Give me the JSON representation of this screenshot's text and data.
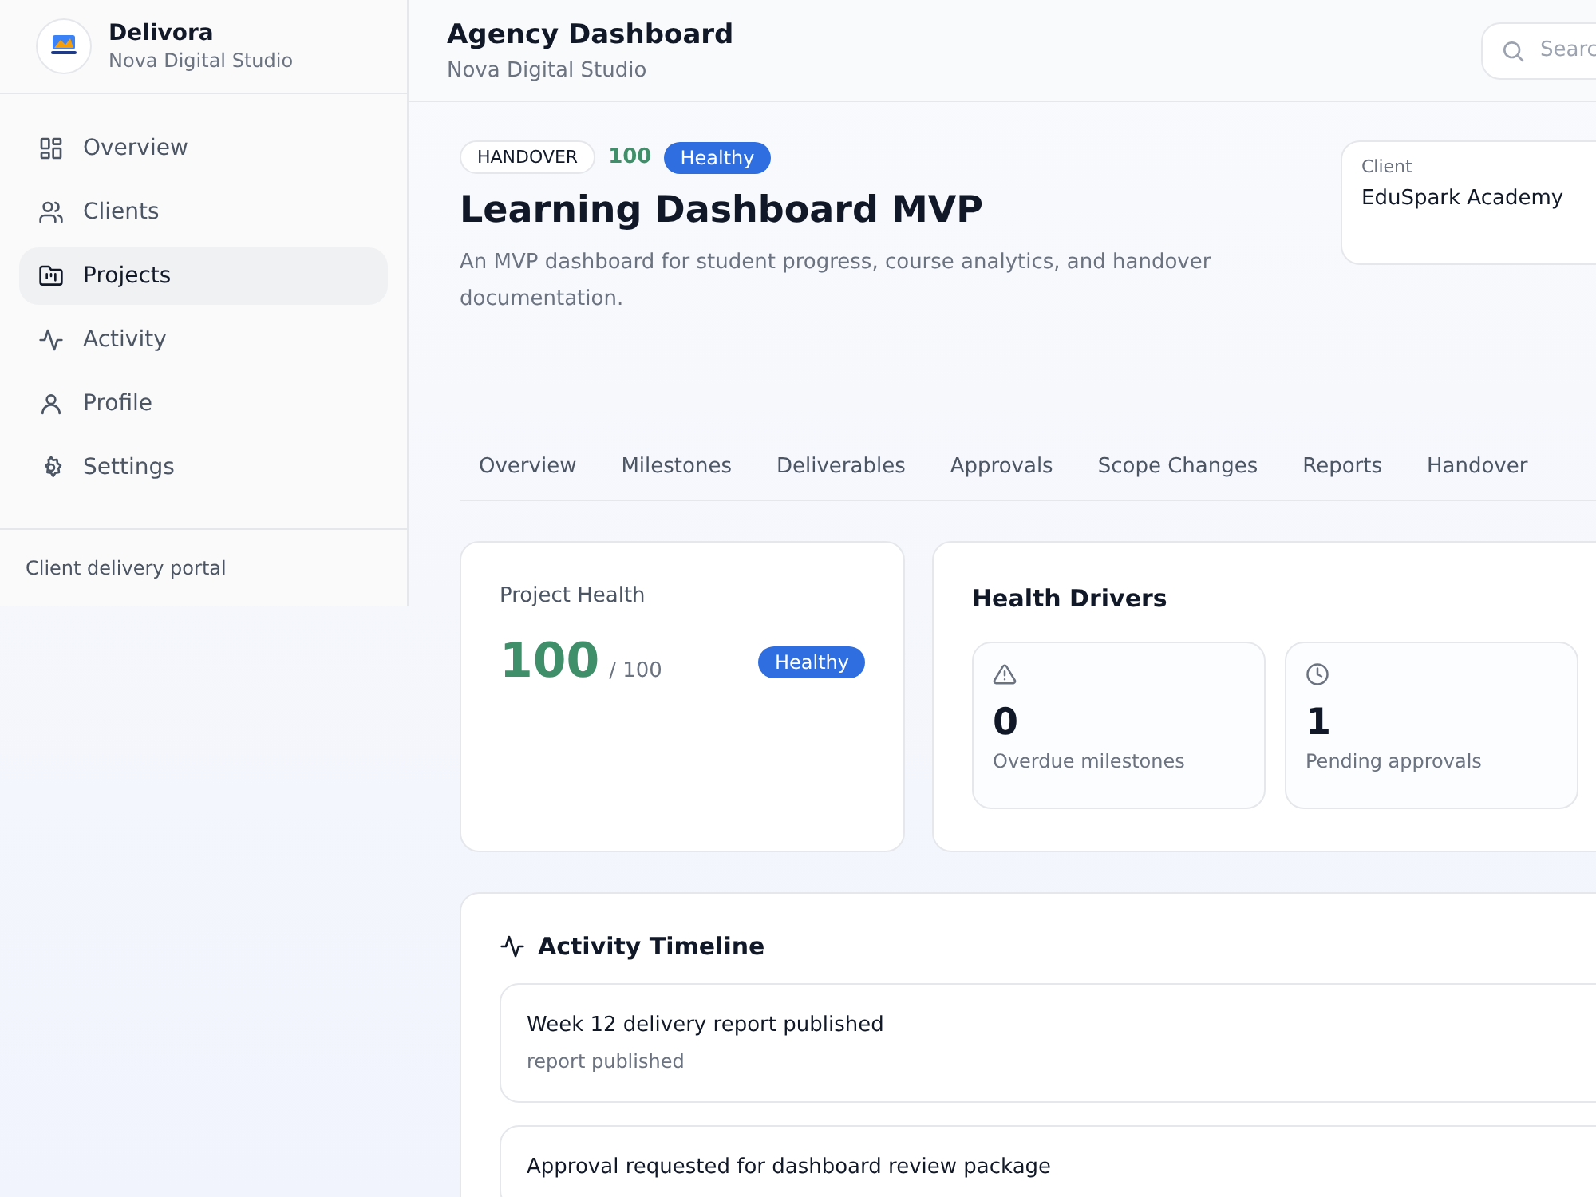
{
  "sidebar": {
    "brand": {
      "name": "Delivora",
      "org": "Nova Digital Studio"
    },
    "items": [
      {
        "label": "Overview",
        "kind": "grid",
        "selected": false
      },
      {
        "label": "Clients",
        "kind": "users",
        "selected": false
      },
      {
        "label": "Projects",
        "kind": "folder",
        "selected": true
      },
      {
        "label": "Activity",
        "kind": "pulse",
        "selected": false
      },
      {
        "label": "Profile",
        "kind": "user",
        "selected": false
      },
      {
        "label": "Settings",
        "kind": "gear",
        "selected": false
      }
    ],
    "footer": "Client delivery portal"
  },
  "header": {
    "title": "Agency Dashboard",
    "subtitle": "Nova Digital Studio",
    "search": {
      "placeholder": "Searc"
    }
  },
  "project": {
    "stage": "HANDOVER",
    "score": "100",
    "status": "Healthy",
    "title": "Learning Dashboard MVP",
    "description": "An MVP dashboard for student progress, course analytics, and handover documentation.",
    "client": {
      "label": "Client",
      "name": "EduSpark Academy"
    }
  },
  "tabs": [
    {
      "label": "Overview",
      "selected": false
    },
    {
      "label": "Milestones",
      "selected": false
    },
    {
      "label": "Deliverables",
      "selected": false
    },
    {
      "label": "Approvals",
      "selected": false
    },
    {
      "label": "Scope Changes",
      "selected": false
    },
    {
      "label": "Reports",
      "selected": false
    },
    {
      "label": "Handover",
      "selected": false
    }
  ],
  "health": {
    "title": "Project Health",
    "score": "100",
    "max": "/ 100",
    "status": "Healthy"
  },
  "drivers": {
    "title": "Health Drivers",
    "items": [
      {
        "kind": "warning",
        "value": "0",
        "label": "Overdue milestones"
      },
      {
        "kind": "clock",
        "value": "1",
        "label": "Pending approvals"
      }
    ]
  },
  "timeline": {
    "title": "Activity Timeline",
    "items": [
      {
        "title": "Week 12 delivery report published",
        "detail": "report published"
      },
      {
        "title": "Approval requested for dashboard review package"
      }
    ]
  }
}
